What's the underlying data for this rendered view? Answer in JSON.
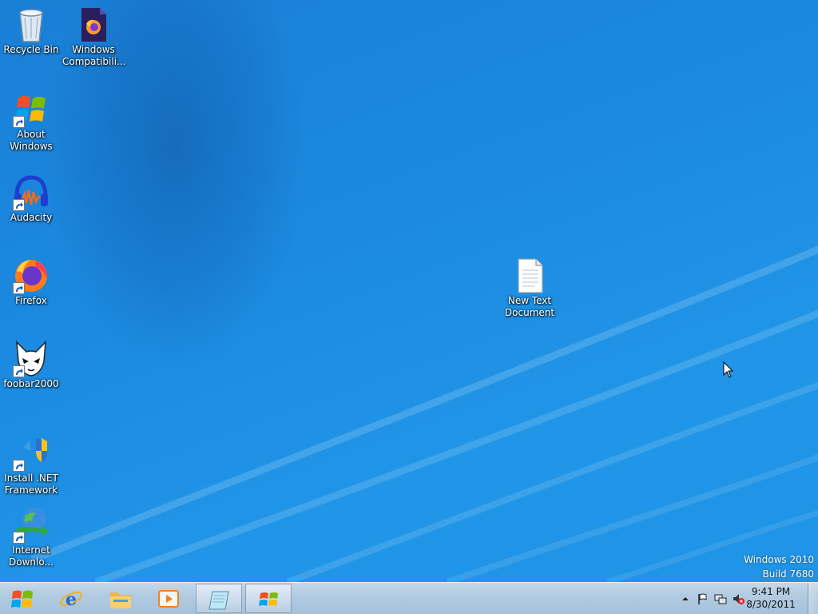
{
  "desktop": {
    "icons": [
      {
        "label": "Recycle Bin",
        "icon": "recycle-bin-icon"
      },
      {
        "label": "Windows\nCompatibili...",
        "icon": "firefox-file-icon"
      },
      {
        "label": "About\nWindows",
        "icon": "windows-logo-icon"
      },
      {
        "label": "Audacity",
        "icon": "audacity-icon"
      },
      {
        "label": "Firefox",
        "icon": "firefox-icon"
      },
      {
        "label": "foobar2000",
        "icon": "foobar2000-icon"
      },
      {
        "label": "Install .NET\nFramework",
        "icon": "dotnet-installer-icon"
      },
      {
        "label": "Internet\nDownlo...",
        "icon": "internet-download-manager-icon"
      },
      {
        "label": "New Text\nDocument",
        "icon": "text-document-icon"
      }
    ],
    "watermark": {
      "line1": "Windows 2010",
      "line2": "Build 7680"
    }
  },
  "taskbar": {
    "start": "start-button",
    "pinned": [
      {
        "name": "internet-explorer-icon"
      },
      {
        "name": "file-explorer-icon"
      },
      {
        "name": "media-player-icon"
      },
      {
        "name": "notepad-icon"
      },
      {
        "name": "windows-logo-icon"
      }
    ],
    "tray": {
      "time": "9:41 PM",
      "date": "8/30/2011"
    }
  },
  "colors": {
    "wallpaper": "#1b8ae0",
    "taskbar": "#b2cbe1"
  }
}
